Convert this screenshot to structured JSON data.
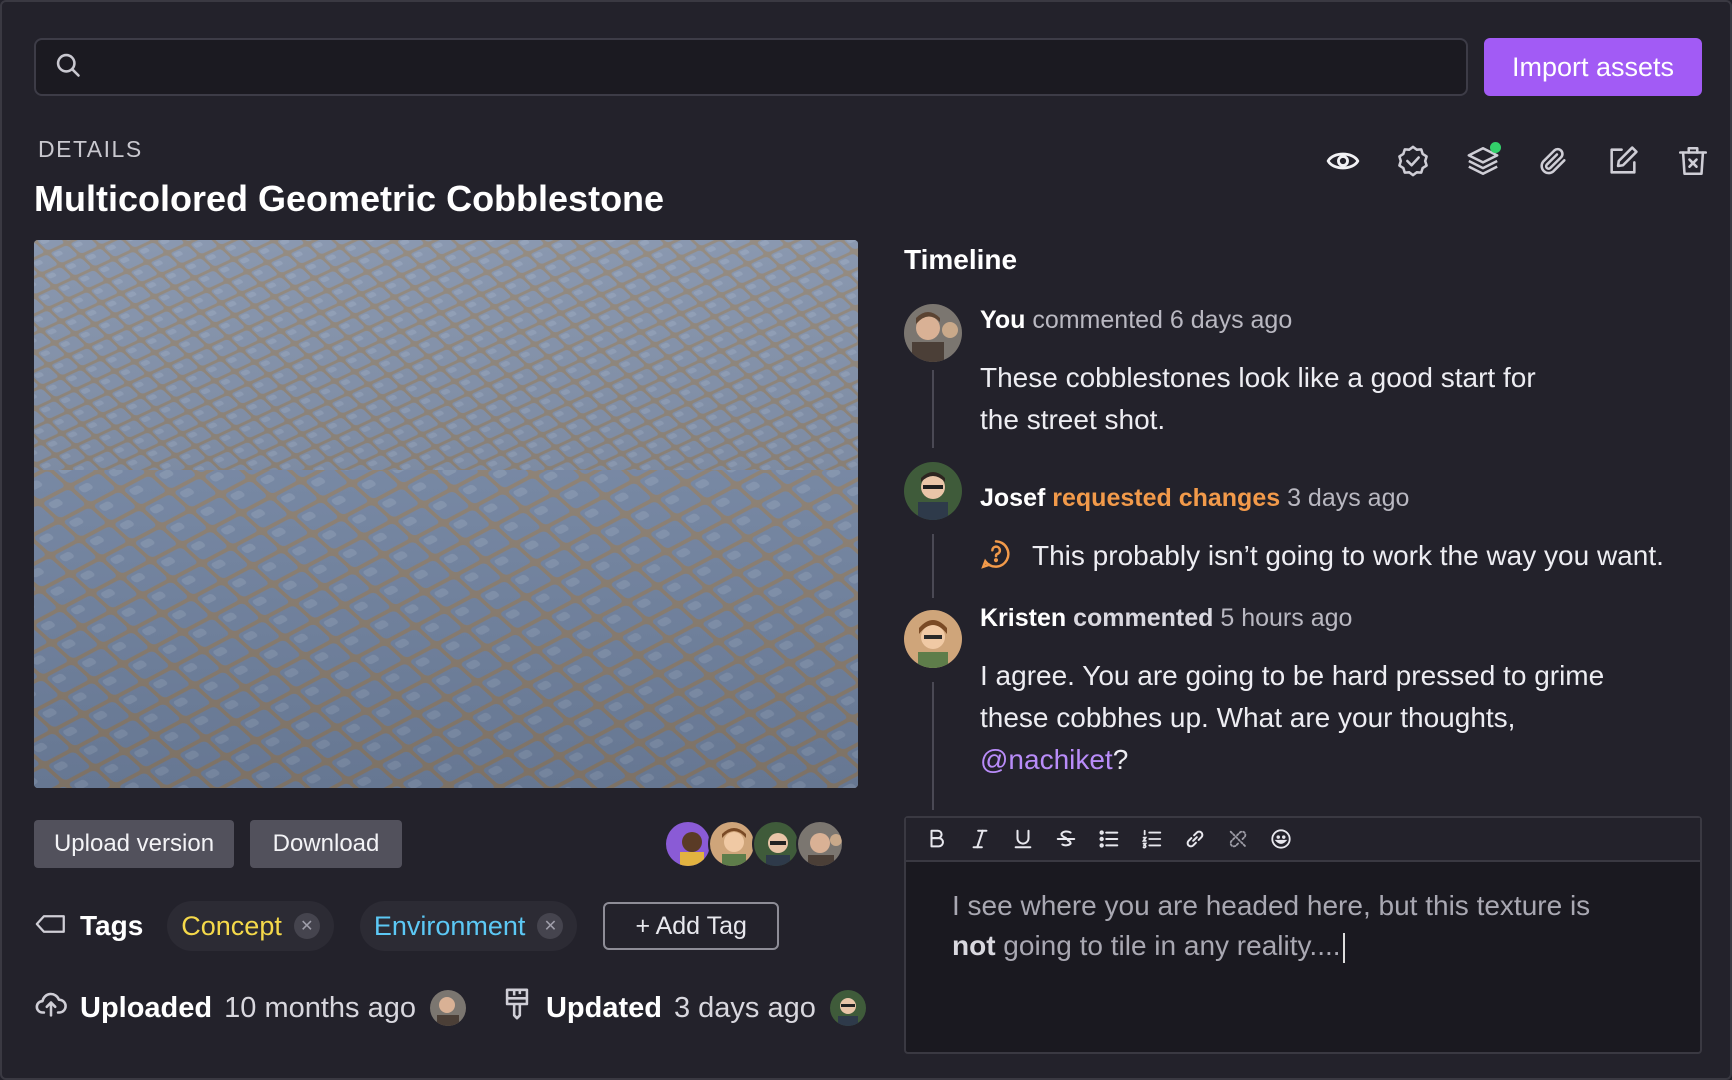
{
  "header": {
    "search": {
      "value": "",
      "placeholder": ""
    },
    "import_label": "Import assets"
  },
  "details": {
    "label": "DETAILS",
    "title": "Multicolored Geometric Cobblestone"
  },
  "actions": [
    "eye-icon",
    "verified-badge-icon",
    "layers-icon",
    "paperclip-icon",
    "edit-icon",
    "trash-icon"
  ],
  "asset_buttons": {
    "upload": "Upload version",
    "download": "Download"
  },
  "tags": {
    "label": "Tags",
    "items": [
      {
        "label": "Concept",
        "color": "#f5d94a"
      },
      {
        "label": "Environment",
        "color": "#5cc8f5"
      }
    ],
    "add_label": "+ Add Tag"
  },
  "meta": {
    "uploaded_label": "Uploaded",
    "uploaded_value": "10 months ago",
    "updated_label": "Updated",
    "updated_value": "3 days ago"
  },
  "timeline": {
    "title": "Timeline",
    "entries": [
      {
        "who": "You",
        "action": "commented",
        "time": "6 days ago",
        "line1": "These cobblestones look like a good start for",
        "line2": "the street shot."
      },
      {
        "who": "Josef",
        "action": "requested changes",
        "time": "3 days ago",
        "body": "This probably isn’t going to work the way you want."
      },
      {
        "who": "Kristen",
        "action": "commented",
        "time": "5 hours ago",
        "line1": "I agree. You are going to be hard pressed to grime",
        "line2": "these cobbhes up. What are your thoughts,",
        "mention": "@nachiket",
        "suffix": "?"
      }
    ]
  },
  "editor": {
    "toolbar": [
      "bold-icon",
      "italic-icon",
      "underline-icon",
      "strikethrough-icon",
      "bullet-list-icon",
      "numbered-list-icon",
      "link-icon",
      "unlink-icon",
      "emoji-icon"
    ],
    "text_line1": "I see where you are headed here, but this texture is",
    "text_bold": "not",
    "text_line2": " going to tile in any reality...."
  },
  "colors": {
    "accent": "#a25bf5",
    "background": "#23222b",
    "warning": "#f29a4a",
    "mention": "#b98cf9",
    "online": "#33d06a"
  }
}
